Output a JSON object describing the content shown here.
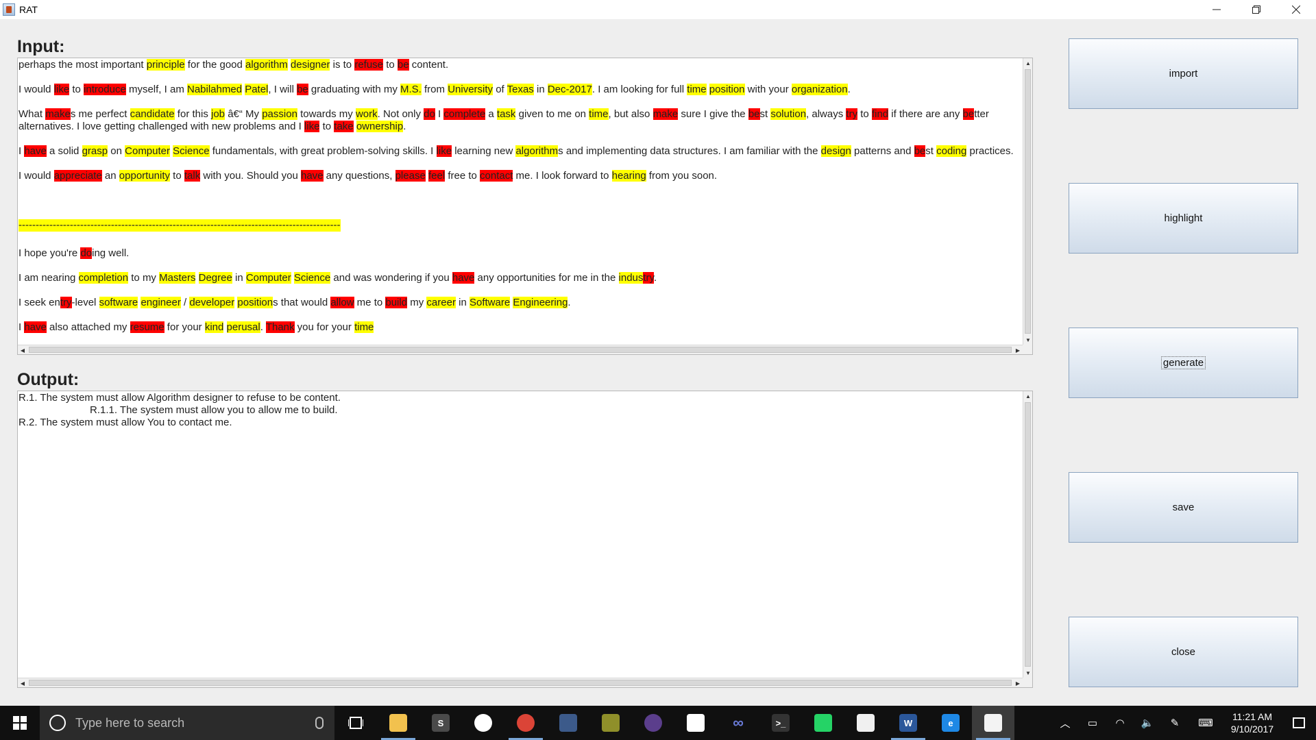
{
  "window": {
    "title": "RAT",
    "controls": [
      "minimize",
      "restore",
      "close"
    ]
  },
  "input": {
    "heading": "Input:",
    "paragraphs": [
      [
        [
          "perhaps the most important ",
          ""
        ],
        [
          "principle",
          "y"
        ],
        [
          " for the good ",
          ""
        ],
        [
          "algorithm",
          "y"
        ],
        [
          " ",
          ""
        ],
        [
          "designer",
          "y"
        ],
        [
          " is to ",
          ""
        ],
        [
          "refuse",
          "r"
        ],
        [
          " to ",
          ""
        ],
        [
          "be",
          "r"
        ],
        [
          " content.",
          ""
        ]
      ],
      [
        [
          "I would ",
          ""
        ],
        [
          "like",
          "r"
        ],
        [
          " to ",
          ""
        ],
        [
          "introduce",
          "r"
        ],
        [
          " myself, I am ",
          ""
        ],
        [
          "Nabilahmed",
          "y"
        ],
        [
          " ",
          ""
        ],
        [
          "Patel",
          "y"
        ],
        [
          ", I will ",
          ""
        ],
        [
          "be",
          "r"
        ],
        [
          " graduating with my ",
          ""
        ],
        [
          "M.S.",
          "y"
        ],
        [
          " from ",
          ""
        ],
        [
          "University",
          "y"
        ],
        [
          " of ",
          ""
        ],
        [
          "Texas",
          "y"
        ],
        [
          " in ",
          ""
        ],
        [
          "Dec-2017",
          "y"
        ],
        [
          ". I am looking for full ",
          ""
        ],
        [
          "time",
          "y"
        ],
        [
          " ",
          ""
        ],
        [
          "position",
          "y"
        ],
        [
          " with your ",
          ""
        ],
        [
          "organization",
          "y"
        ],
        [
          ".",
          ""
        ]
      ],
      [
        [
          "What ",
          ""
        ],
        [
          "make",
          "r"
        ],
        [
          "s me perfect ",
          ""
        ],
        [
          "candidate",
          "y"
        ],
        [
          " for this ",
          ""
        ],
        [
          "job",
          "y"
        ],
        [
          " â€“ My ",
          ""
        ],
        [
          "passion",
          "y"
        ],
        [
          " towards my ",
          ""
        ],
        [
          "work",
          "y"
        ],
        [
          ". Not only ",
          ""
        ],
        [
          "do",
          "r"
        ],
        [
          " I ",
          ""
        ],
        [
          "complete",
          "r"
        ],
        [
          " a ",
          ""
        ],
        [
          "task",
          "y"
        ],
        [
          " given to me on ",
          ""
        ],
        [
          "time",
          "y"
        ],
        [
          ", but also ",
          ""
        ],
        [
          "make",
          "r"
        ],
        [
          " sure I give the ",
          ""
        ],
        [
          "be",
          "r"
        ],
        [
          "st ",
          ""
        ],
        [
          "solution",
          "y"
        ],
        [
          ", always ",
          ""
        ],
        [
          "try",
          "r"
        ],
        [
          " to ",
          ""
        ],
        [
          "find",
          "r"
        ],
        [
          " if there are any ",
          ""
        ],
        [
          "be",
          "r"
        ],
        [
          "tter alternatives. I love getting challenged with new problems and I ",
          ""
        ],
        [
          "like",
          "r"
        ],
        [
          " to ",
          ""
        ],
        [
          "take",
          "r"
        ],
        [
          " ",
          ""
        ],
        [
          "ownership",
          "y"
        ],
        [
          ".",
          ""
        ]
      ],
      [
        [
          "I ",
          ""
        ],
        [
          "have",
          "r"
        ],
        [
          " a solid ",
          ""
        ],
        [
          "grasp",
          "y"
        ],
        [
          " on ",
          ""
        ],
        [
          "Computer",
          "y"
        ],
        [
          " ",
          ""
        ],
        [
          "Science",
          "y"
        ],
        [
          " fundamentals, with great problem-solving skills. I ",
          ""
        ],
        [
          "like",
          "r"
        ],
        [
          " learning new ",
          ""
        ],
        [
          "algorithm",
          "y"
        ],
        [
          "s and implementing data structures. I am familiar with the ",
          ""
        ],
        [
          "design",
          "y"
        ],
        [
          " patterns and ",
          ""
        ],
        [
          "be",
          "r"
        ],
        [
          "st ",
          ""
        ],
        [
          "coding",
          "y"
        ],
        [
          " practices.",
          ""
        ]
      ],
      [
        [
          "I would ",
          ""
        ],
        [
          "appreciate",
          "r"
        ],
        [
          " an ",
          ""
        ],
        [
          "opportunity",
          "y"
        ],
        [
          " to ",
          ""
        ],
        [
          "talk",
          "r"
        ],
        [
          " with you. Should you ",
          ""
        ],
        [
          "have",
          "r"
        ],
        [
          " any questions, ",
          ""
        ],
        [
          "please",
          "r"
        ],
        [
          " ",
          ""
        ],
        [
          "feel",
          "r"
        ],
        [
          " free to ",
          ""
        ],
        [
          "contact",
          "r"
        ],
        [
          " me. I look forward to ",
          ""
        ],
        [
          "hearing",
          "y"
        ],
        [
          " from you soon.",
          ""
        ]
      ],
      [],
      [
        [
          "---------------------------------------------------------------------------------------------------------------------------------------------------------",
          "sep"
        ]
      ],
      [
        [
          "I hope you're ",
          ""
        ],
        [
          "do",
          "r"
        ],
        [
          "ing well.",
          ""
        ]
      ],
      [
        [
          "I am nearing ",
          ""
        ],
        [
          "completion",
          "y"
        ],
        [
          " to my ",
          ""
        ],
        [
          "Masters",
          "y"
        ],
        [
          " ",
          ""
        ],
        [
          "Degree",
          "y"
        ],
        [
          " in ",
          ""
        ],
        [
          "Computer",
          "y"
        ],
        [
          " ",
          ""
        ],
        [
          "Science",
          "y"
        ],
        [
          " and was wondering if you ",
          ""
        ],
        [
          "have",
          "r"
        ],
        [
          " any opportunities for me in the ",
          ""
        ],
        [
          "indus",
          "y"
        ],
        [
          "try",
          "r"
        ],
        [
          ".",
          ""
        ]
      ],
      [
        [
          "I seek en",
          ""
        ],
        [
          "try",
          "r"
        ],
        [
          "-level ",
          ""
        ],
        [
          "software",
          "y"
        ],
        [
          " ",
          ""
        ],
        [
          "engineer",
          "y"
        ],
        [
          " / ",
          ""
        ],
        [
          "developer",
          "y"
        ],
        [
          " ",
          ""
        ],
        [
          "position",
          "y"
        ],
        [
          "s that would ",
          ""
        ],
        [
          "allow",
          "r"
        ],
        [
          " me to ",
          ""
        ],
        [
          "build",
          "r"
        ],
        [
          " my ",
          ""
        ],
        [
          "career",
          "y"
        ],
        [
          " in ",
          ""
        ],
        [
          "Software",
          "y"
        ],
        [
          " ",
          ""
        ],
        [
          "Engineering",
          "y"
        ],
        [
          ".",
          ""
        ]
      ],
      [
        [
          "I ",
          ""
        ],
        [
          "have",
          "r"
        ],
        [
          " also attached my ",
          ""
        ],
        [
          "resume",
          "r"
        ],
        [
          " for your ",
          ""
        ],
        [
          "kind",
          "y"
        ],
        [
          " ",
          ""
        ],
        [
          "perusal",
          "y"
        ],
        [
          ". ",
          ""
        ],
        [
          "Thank",
          "r"
        ],
        [
          " you for your ",
          ""
        ],
        [
          "time",
          "y"
        ]
      ]
    ]
  },
  "output": {
    "heading": "Output:",
    "lines": [
      {
        "text": "R.1. The system must allow Algorithm designer to refuse to be content.",
        "indent": false
      },
      {
        "text": "R.1.1. The system must allow you to allow me to build.",
        "indent": true
      },
      {
        "text": "R.2. The system must allow You to contact me.",
        "indent": false
      }
    ]
  },
  "buttons": {
    "import": "import",
    "highlight": "highlight",
    "generate": "generate",
    "save": "save",
    "close": "close"
  },
  "taskbar": {
    "search_placeholder": "Type here to search",
    "apps": [
      "file-explorer-icon",
      "sublime-text-icon",
      "github-icon",
      "chrome-icon",
      "visual-studio-icon",
      "paint-tool-icon",
      "eclipse-icon",
      "mail-icon",
      "infinity-icon",
      "terminal-icon",
      "whatsapp-icon",
      "movie-maker-icon",
      "word-icon",
      "edge-icon",
      "java-icon"
    ],
    "time": "11:21 AM",
    "date": "9/10/2017"
  },
  "colors": {
    "highlight_yellow": "#ffff00",
    "highlight_red": "#ff0000",
    "button_gradient_top": "#fbfcfe",
    "button_gradient_bottom": "#cfdbe9",
    "taskbar": "#101010"
  }
}
